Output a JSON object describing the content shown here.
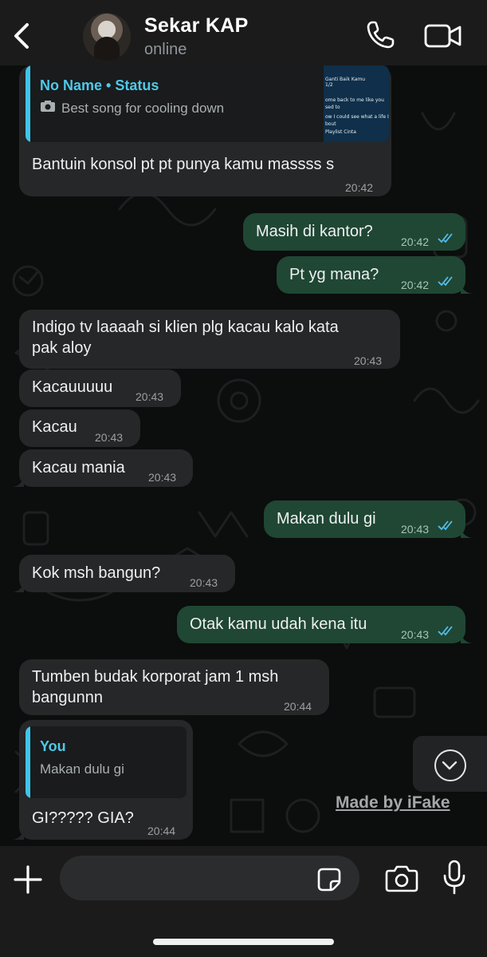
{
  "header": {
    "contact_name": "Sekar KAP",
    "contact_status": "online"
  },
  "messages": [
    {
      "direction": "in",
      "quote": {
        "name": "No Name • Status",
        "text": "Best song for cooling down",
        "thumb_lines": [
          "Ganti Baik Kamu",
          "1/2",
          "ome back to me like you",
          "sed to",
          "ow I could see what a life I",
          "bout",
          "Playlist Cinta"
        ]
      },
      "text": "Bantuin konsol pt pt punya kamu massss s",
      "time": "20:42"
    },
    {
      "direction": "out",
      "text": "Masih di kantor?",
      "time": "20:42"
    },
    {
      "direction": "out",
      "text": "Pt yg mana?",
      "time": "20:42"
    },
    {
      "direction": "in",
      "text_lines": [
        "Indigo tv laaaah si klien plg kacau kalo kata",
        "pak aloy"
      ],
      "time": "20:43"
    },
    {
      "direction": "in",
      "text": "Kacauuuuu",
      "time": "20:43"
    },
    {
      "direction": "in",
      "text": "Kacau",
      "time": "20:43"
    },
    {
      "direction": "in",
      "text": "Kacau mania",
      "time": "20:43"
    },
    {
      "direction": "out",
      "text": "Makan dulu gi",
      "time": "20:43"
    },
    {
      "direction": "in",
      "text": "Kok msh bangun?",
      "time": "20:43"
    },
    {
      "direction": "out",
      "text": "Otak kamu udah kena itu",
      "time": "20:43"
    },
    {
      "direction": "in",
      "text_lines": [
        "Tumben budak korporat jam 1 msh",
        "bangunnn"
      ],
      "time": "20:44"
    },
    {
      "direction": "in",
      "quote": {
        "name": "You",
        "text": "Makan dulu gi"
      },
      "text": "GI????? GIA?",
      "time": "20:44"
    }
  ],
  "watermark": "Made by iFake",
  "composer": {
    "placeholder": ""
  },
  "icons": {
    "back": "chevron-left-icon",
    "call": "phone-icon",
    "video": "video-camera-icon",
    "scroll": "chevron-down-icon",
    "add": "plus-icon",
    "sticker": "sticker-icon",
    "camera": "camera-icon",
    "mic": "microphone-icon"
  },
  "colors": {
    "incoming_bubble": "#262728",
    "outgoing_bubble": "#1f4734",
    "quote_accent": "#3fc6e9",
    "read_tick": "#53bdeb"
  }
}
